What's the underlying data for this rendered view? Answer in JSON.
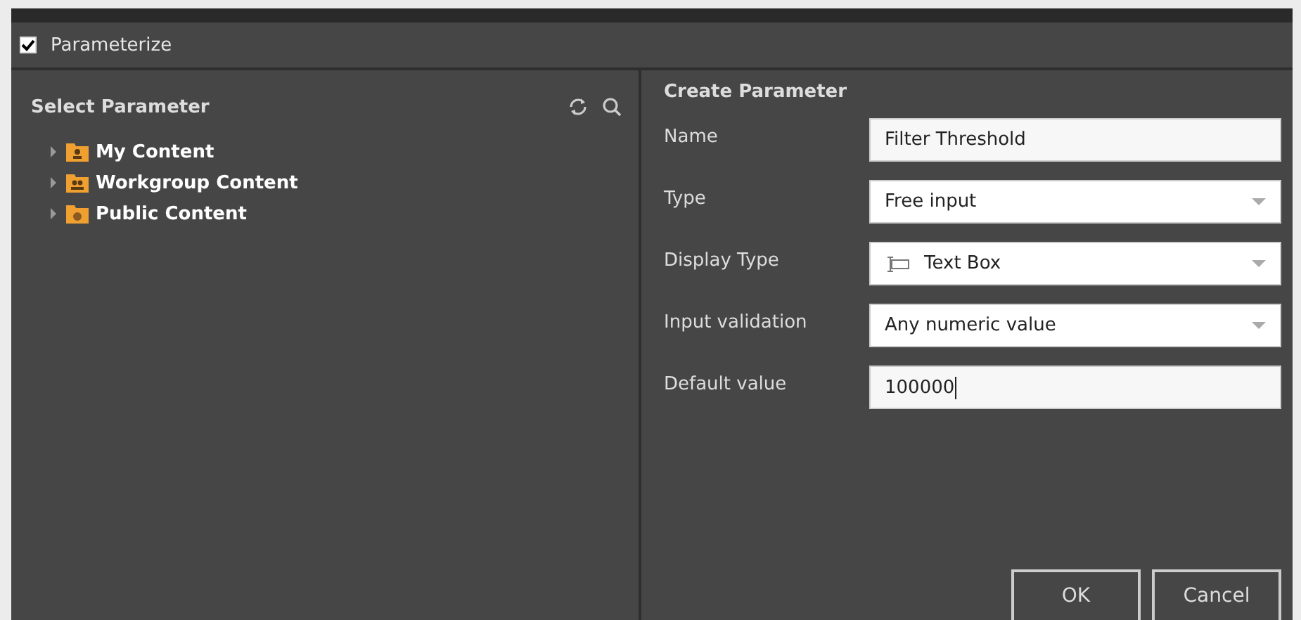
{
  "parameterize": {
    "label": "Parameterize",
    "checked": true
  },
  "select_parameter": {
    "title": "Select Parameter",
    "tree": [
      {
        "label": "My Content",
        "kind": "user",
        "expanded": false
      },
      {
        "label": "Workgroup Content",
        "kind": "group",
        "expanded": false
      },
      {
        "label": "Public Content",
        "kind": "public",
        "expanded": false
      }
    ]
  },
  "create_parameter": {
    "title": "Create Parameter",
    "fields": [
      {
        "label": "Name",
        "kind": "text",
        "value": "Filter Threshold"
      },
      {
        "label": "Type",
        "kind": "select",
        "value": "Free input"
      },
      {
        "label": "Display Type",
        "kind": "icon-select",
        "value": "Text Box"
      },
      {
        "label": "Input validation",
        "kind": "select",
        "value": "Any numeric value"
      },
      {
        "label": "Default value",
        "kind": "text",
        "value": "100000",
        "focused": true
      }
    ]
  },
  "buttons": [
    "OK",
    "Cancel"
  ]
}
